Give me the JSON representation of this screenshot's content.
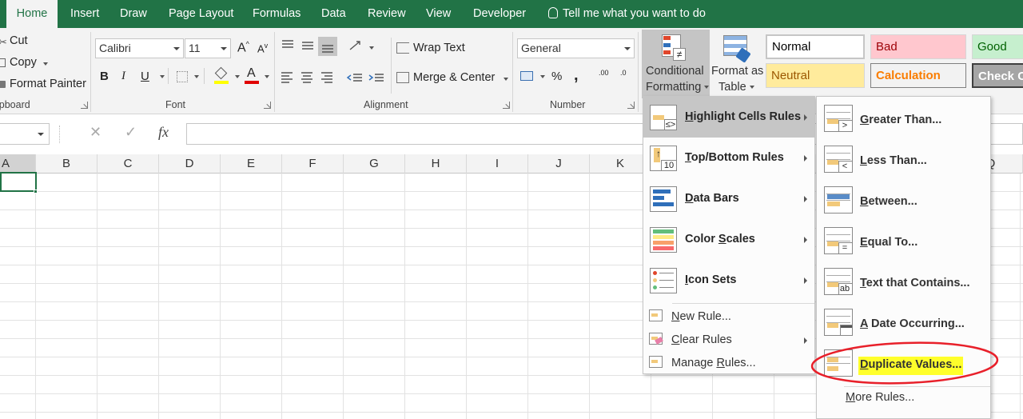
{
  "tabs": [
    "Home",
    "Insert",
    "Draw",
    "Page Layout",
    "Formulas",
    "Data",
    "Review",
    "View",
    "Developer"
  ],
  "tell_me": "Tell me what you want to do",
  "clipboard": {
    "cut": "Cut",
    "copy": "Copy",
    "format_painter": "Format Painter",
    "label": "ipboard"
  },
  "font": {
    "name": "Calibri",
    "size": "11",
    "label": "Font",
    "bold": "B",
    "italic": "I",
    "underline": "U",
    "grow": "A",
    "shrink": "A",
    "font_color": "A"
  },
  "alignment": {
    "wrap_text": "Wrap Text",
    "merge_center": "Merge & Center",
    "label": "Alignment"
  },
  "number": {
    "format": "General",
    "label": "Number",
    "percent": "%",
    "comma": ",",
    "inc_dec": ".00",
    "dec_dec": ".0"
  },
  "styles_group": {
    "conditional_formatting_line1": "Conditional",
    "conditional_formatting_line2": "Formatting",
    "format_as_table_line1": "Format as",
    "format_as_table_line2": "Table"
  },
  "styles": [
    {
      "name": "Normal",
      "bg": "#ffffff",
      "fg": "#000000"
    },
    {
      "name": "Bad",
      "bg": "#ffc7ce",
      "fg": "#9c0006"
    },
    {
      "name": "Good",
      "bg": "#c6efce",
      "fg": "#006100"
    },
    {
      "name": "Neutral",
      "bg": "#ffeb9c",
      "fg": "#9c5700"
    },
    {
      "name": "Calculation",
      "bg": "#f2f2f2",
      "fg": "#fa7d00"
    },
    {
      "name": "Check C",
      "bg": "#a5a5a5",
      "fg": "#ffffff"
    }
  ],
  "formula_bar": {
    "cancel": "✕",
    "enter": "✓",
    "fx": "fx"
  },
  "columns": [
    "A",
    "B",
    "C",
    "D",
    "E",
    "F",
    "G",
    "H",
    "I",
    "J",
    "K",
    "Q"
  ],
  "cf_menu": {
    "items": [
      {
        "pre": "",
        "acc": "H",
        "post": "ighlight Cells Rules",
        "submenu": true,
        "selected": true
      },
      {
        "pre": "",
        "acc": "T",
        "post": "op/Bottom Rules",
        "submenu": true
      },
      {
        "pre": "",
        "acc": "D",
        "post": "ata Bars",
        "submenu": true
      },
      {
        "pre": "Color ",
        "acc": "S",
        "post": "cales",
        "submenu": true
      },
      {
        "pre": "",
        "acc": "I",
        "post": "con Sets",
        "submenu": true
      }
    ],
    "small": [
      {
        "pre": "",
        "acc": "N",
        "post": "ew Rule..."
      },
      {
        "pre": "",
        "acc": "C",
        "post": "lear Rules"
      },
      {
        "pre": "Manage ",
        "acc": "R",
        "post": "ules..."
      }
    ]
  },
  "hc_menu": {
    "items": [
      {
        "pre": "",
        "acc": "G",
        "post": "reater Than...",
        "sym": ">"
      },
      {
        "pre": "",
        "acc": "L",
        "post": "ess Than...",
        "sym": "<"
      },
      {
        "pre": "",
        "acc": "B",
        "post": "etween...",
        "sym": ""
      },
      {
        "pre": "",
        "acc": "E",
        "post": "qual To...",
        "sym": "="
      },
      {
        "pre": "",
        "acc": "T",
        "post": "ext that Contains...",
        "sym": "ab"
      },
      {
        "pre": "",
        "acc": "A",
        "post": " Date Occurring...",
        "sym": ""
      },
      {
        "pre": "",
        "acc": "D",
        "post": "uplicate Values...",
        "sym": ""
      }
    ],
    "more": {
      "pre": "",
      "acc": "M",
      "post": "ore Rules..."
    }
  },
  "colors": {
    "excel_green": "#217346",
    "highlight": "#ffff2b",
    "annotation": "#e8202a",
    "font_red": "#e00000",
    "fill_yellow": "#ffff00"
  }
}
